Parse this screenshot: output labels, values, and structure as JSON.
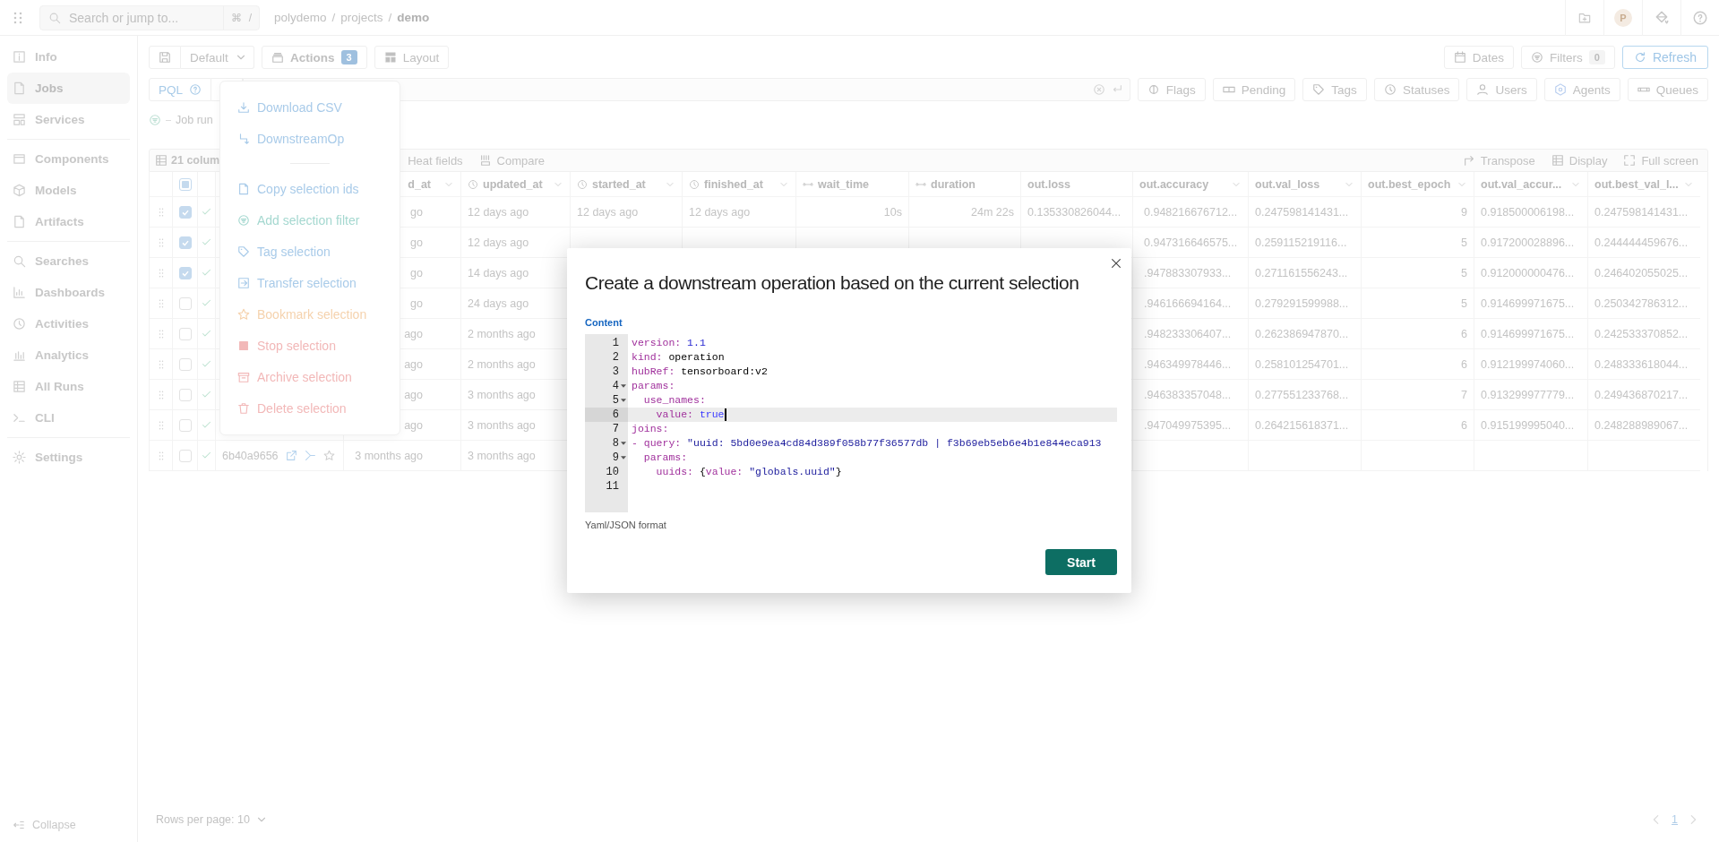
{
  "top_bar": {
    "search": {
      "placeholder": "Search or jump to...",
      "shortcut": [
        "⌘",
        "/"
      ]
    },
    "breadcrumb": [
      {
        "label": "polydemo",
        "kind": "link"
      },
      {
        "label": "/",
        "kind": "separator"
      },
      {
        "label": "projects",
        "kind": "link"
      },
      {
        "label": "/",
        "kind": "separator"
      },
      {
        "label": "demo",
        "kind": "current"
      }
    ],
    "avatar": "P"
  },
  "sidebar": {
    "groups": [
      {
        "items": [
          {
            "label": "Info",
            "selected": false
          },
          {
            "label": "Jobs",
            "selected": true
          },
          {
            "label": "Services",
            "selected": false
          }
        ]
      },
      {
        "items": [
          {
            "label": "Components",
            "selected": false
          },
          {
            "label": "Models",
            "selected": false
          },
          {
            "label": "Artifacts",
            "selected": false
          }
        ]
      },
      {
        "items": [
          {
            "label": "Searches",
            "selected": false
          },
          {
            "label": "Dashboards",
            "selected": false
          },
          {
            "label": "Activities",
            "selected": false
          },
          {
            "label": "Analytics",
            "selected": false
          },
          {
            "label": "All Runs",
            "selected": false
          },
          {
            "label": "CLI",
            "selected": false
          }
        ]
      },
      {
        "items": [
          {
            "label": "Settings",
            "selected": false
          }
        ]
      }
    ],
    "collapse": "Collapse"
  },
  "toolbar": {
    "view": "Default",
    "actions": {
      "label": "Actions",
      "count": "3"
    },
    "layout": "Layout",
    "dates": "Dates",
    "filters": {
      "label": "Filters",
      "count": "0"
    },
    "refresh": "Refresh"
  },
  "query_bar": {
    "language": "PQL",
    "chips": [
      "Flags",
      "Pending",
      "Tags",
      "Statuses",
      "Users",
      "Agents",
      "Queues"
    ]
  },
  "query_hint": "Job run",
  "table_toolbar": {
    "columns": "21 colum",
    "left": [
      "Heat fields",
      "Compare"
    ],
    "right": [
      "Transpose",
      "Display",
      "Full screen"
    ]
  },
  "table": {
    "select_all": {
      "indeterminate": true
    },
    "columns": [
      "d_at",
      "updated_at",
      "started_at",
      "finished_at",
      "wait_time",
      "duration",
      "out.loss",
      "out.accuracy",
      "out.val_loss",
      "out.best_epoch",
      "out.val_accur...",
      "out.best_val_l..."
    ],
    "rows": [
      {
        "checked": true,
        "cells": [
          "go",
          "12 days ago",
          "12 days ago",
          "12 days ago",
          "10s",
          "24m 22s",
          "0.135330826044...",
          "0.948216676712...",
          "0.247598141431...",
          "9",
          "0.918500006198...",
          "0.247598141431..."
        ]
      },
      {
        "checked": true,
        "cells": [
          "go",
          "12 days ago",
          null,
          null,
          null,
          null,
          null,
          "0.947316646575...",
          "0.259115219116...",
          "5",
          "0.917200028896...",
          "0.244444459676..."
        ]
      },
      {
        "checked": true,
        "cells": [
          "go",
          "14 days ago",
          null,
          null,
          null,
          null,
          null,
          ".947883307933...",
          "0.271161556243...",
          "5",
          "0.912000000476...",
          "0.246402055025..."
        ]
      },
      {
        "checked": false,
        "cells": [
          "go",
          "24 days ago",
          null,
          null,
          null,
          null,
          null,
          ".946166694164...",
          "0.279291599988...",
          "5",
          "0.914699971675...",
          "0.250342786312..."
        ]
      },
      {
        "checked": false,
        "cells": [
          "ago",
          "2 months ago",
          null,
          null,
          null,
          null,
          null,
          ".948233306407...",
          "0.262386947870...",
          "6",
          "0.914699971675...",
          "0.242533370852..."
        ]
      },
      {
        "checked": false,
        "cells": [
          "ago",
          "2 months ago",
          null,
          null,
          null,
          null,
          null,
          ".946349978446...",
          "0.258101254701...",
          "6",
          "0.912199974060...",
          "0.248333618044..."
        ]
      },
      {
        "checked": false,
        "cells": [
          "ago",
          "3 months ago",
          null,
          null,
          null,
          null,
          null,
          ".946383357048...",
          "0.277551233768...",
          "7",
          "0.913299977779...",
          "0.249436870217..."
        ]
      },
      {
        "checked": false,
        "cells": [
          "ago",
          "3 months ago",
          null,
          null,
          null,
          null,
          null,
          ".947049975395...",
          "0.264215618371...",
          "6",
          "0.915199995040...",
          "0.248288989067..."
        ]
      },
      {
        "checked": false,
        "uuid": "6b40a9656",
        "cells": [
          "3 months ago",
          "3 months ago"
        ]
      }
    ]
  },
  "footer": {
    "rows_per_page": "Rows per page: 10",
    "page": "1"
  },
  "actions_menu": [
    {
      "label": "Download CSV",
      "kind": "info"
    },
    {
      "label": "DownstreamOp",
      "kind": "info"
    },
    {
      "kind": "divider"
    },
    {
      "label": "Copy selection ids",
      "kind": "info"
    },
    {
      "label": "Add selection filter",
      "kind": "success"
    },
    {
      "label": "Tag selection",
      "kind": "info"
    },
    {
      "label": "Transfer selection",
      "kind": "info"
    },
    {
      "label": "Bookmark selection",
      "kind": "warning"
    },
    {
      "label": "Stop selection",
      "kind": "danger"
    },
    {
      "label": "Archive selection",
      "kind": "danger"
    },
    {
      "label": "Delete selection",
      "kind": "danger"
    }
  ],
  "modal": {
    "title": "Create a downstream operation based on the current selection",
    "field_label": "Content",
    "lines": [
      {
        "number": "1",
        "fold": false,
        "selected": false,
        "tokens": [
          {
            "kind": "key",
            "text": "version:"
          },
          {
            "kind": "number",
            "text": " 1.1"
          }
        ]
      },
      {
        "number": "2",
        "fold": false,
        "selected": false,
        "tokens": [
          {
            "kind": "key",
            "text": "kind:"
          },
          {
            "kind": "plain",
            "text": " operation"
          }
        ]
      },
      {
        "number": "3",
        "fold": false,
        "selected": false,
        "tokens": [
          {
            "kind": "key",
            "text": "hubRef:"
          },
          {
            "kind": "plain",
            "text": " tensorboard:v2"
          }
        ]
      },
      {
        "number": "4",
        "fold": true,
        "selected": false,
        "tokens": [
          {
            "kind": "key",
            "text": "params:"
          }
        ]
      },
      {
        "number": "5",
        "fold": true,
        "selected": false,
        "tokens": [
          {
            "kind": "key",
            "text": "  use_names:"
          }
        ]
      },
      {
        "number": "6",
        "fold": false,
        "selected": true,
        "tokens": [
          {
            "kind": "key",
            "text": "    value:"
          },
          {
            "kind": "atom",
            "text": " true"
          }
        ]
      },
      {
        "number": "7",
        "fold": false,
        "selected": false,
        "tokens": [
          {
            "kind": "key",
            "text": "joins:"
          }
        ]
      },
      {
        "number": "8",
        "fold": true,
        "selected": false,
        "tokens": [
          {
            "kind": "key",
            "text": "- query:"
          },
          {
            "kind": "string",
            "text": " \"uuid: 5bd0e9ea4cd84d389f058b77f36577db | f3b69eb5eb6e4b1e844eca913"
          }
        ]
      },
      {
        "number": "9",
        "fold": true,
        "selected": false,
        "tokens": [
          {
            "kind": "key",
            "text": "  params:"
          }
        ]
      },
      {
        "number": "10",
        "fold": false,
        "selected": false,
        "tokens": [
          {
            "kind": "key",
            "text": "    uuids:"
          },
          {
            "kind": "plain",
            "text": " {"
          },
          {
            "kind": "key",
            "text": "value:"
          },
          {
            "kind": "string",
            "text": " \"globals.uuid\""
          },
          {
            "kind": "plain",
            "text": "}"
          }
        ]
      },
      {
        "number": "11",
        "fold": false,
        "selected": false
      }
    ],
    "help": "Yaml/JSON format",
    "button": "Start"
  }
}
